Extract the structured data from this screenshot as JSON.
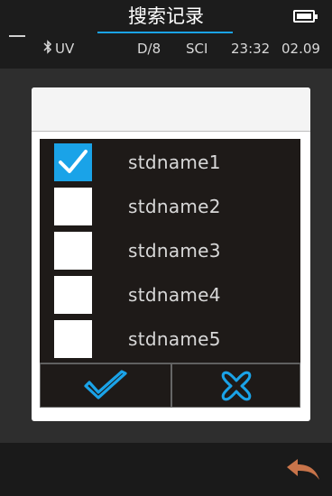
{
  "header": {
    "title": "搜索记录",
    "battery_icon": "battery-full-icon"
  },
  "status": {
    "bluetooth_icon": "bluetooth-icon",
    "uv": "UV",
    "geometry": "D/8",
    "mode": "SCI",
    "time": "23:32",
    "date": "02.09"
  },
  "dialog": {
    "items": [
      {
        "label": "stdname1",
        "checked": true
      },
      {
        "label": "stdname2",
        "checked": false
      },
      {
        "label": "stdname3",
        "checked": false
      },
      {
        "label": "stdname4",
        "checked": false
      },
      {
        "label": "stdname5",
        "checked": false
      }
    ],
    "confirm_icon": "checkmark-icon",
    "cancel_icon": "cross-icon"
  },
  "footer": {
    "back_icon": "back-arrow-icon"
  },
  "colors": {
    "accent": "#1aa3e8",
    "background": "#2e2e2e",
    "list_background": "#1e1a18",
    "back_arrow": "#c8744a"
  }
}
